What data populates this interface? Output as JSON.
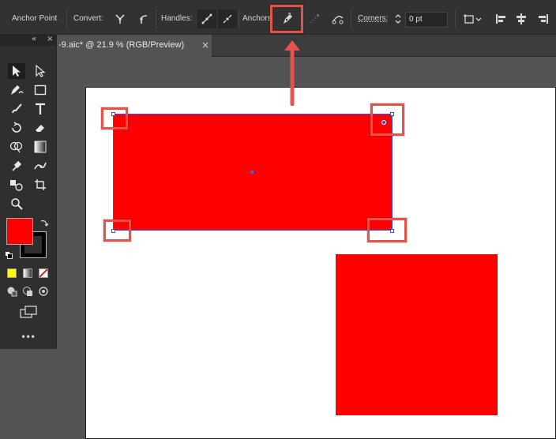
{
  "control_bar": {
    "anchor_point_label": "Anchor Point",
    "convert_label": "Convert:",
    "handles_label": "Handles:",
    "anchors_label": "Anchors",
    "corners_label": "Corners:",
    "corners_value": "0 pt"
  },
  "document_tab": {
    "title": "-9.aic* @ 21.9 % (RGB/Preview)",
    "close_glyph": "×"
  },
  "tools_panel": {
    "collapse_glyph": "«",
    "close_glyph": "×",
    "more_glyph": "•••",
    "fill_color": "#ff0000",
    "stroke_color": "#000000"
  },
  "canvas": {
    "artboard_color": "#ffffff",
    "shape_color": "#ff0000",
    "selection_color": "#3a4fd8",
    "highlight_color": "#e5534b"
  }
}
